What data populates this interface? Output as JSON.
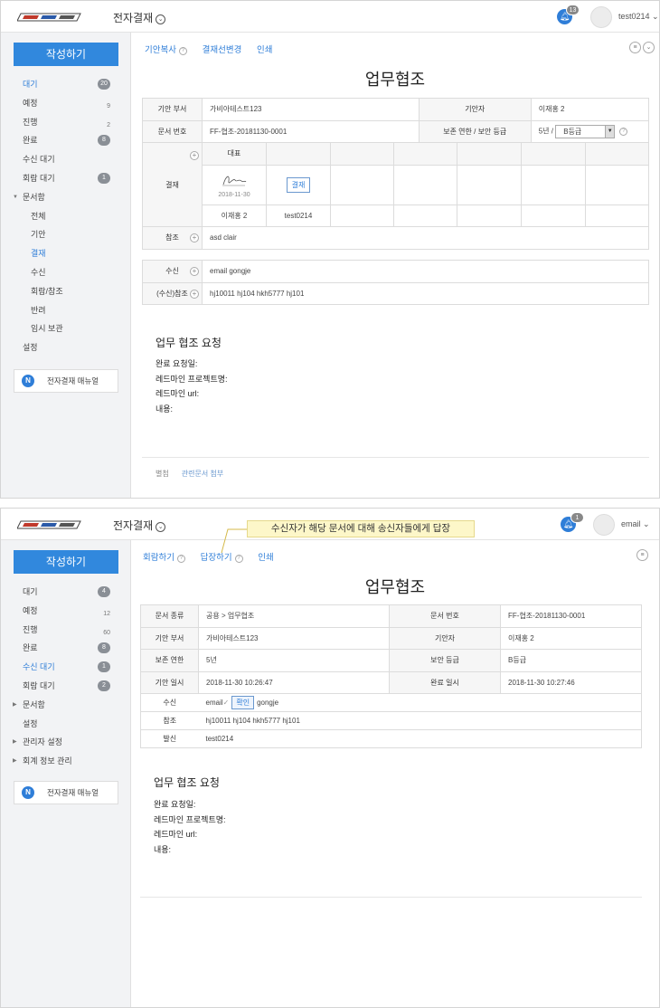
{
  "panel1": {
    "app_title": "전자결재",
    "notification_count": "13",
    "username": "test0214",
    "sidebar": {
      "write_button": "작성하기",
      "items": [
        {
          "label": "대기",
          "count": "20",
          "badge": true
        },
        {
          "label": "예정",
          "count": "9",
          "badge": false
        },
        {
          "label": "진행",
          "count": "2",
          "badge": false
        },
        {
          "label": "완료",
          "count": "8",
          "badge": true
        },
        {
          "label": "수신 대기",
          "count": "",
          "badge": false
        },
        {
          "label": "회람 대기",
          "count": "1",
          "badge": true
        },
        {
          "label": "문서함",
          "count": "",
          "badge": false
        },
        {
          "label": "전체",
          "count": "",
          "badge": false
        },
        {
          "label": "기안",
          "count": "",
          "badge": false
        },
        {
          "label": "결재",
          "count": "",
          "badge": false
        },
        {
          "label": "수신",
          "count": "",
          "badge": false
        },
        {
          "label": "회람/참조",
          "count": "",
          "badge": false
        },
        {
          "label": "반려",
          "count": "",
          "badge": false
        },
        {
          "label": "임시 보관",
          "count": "",
          "badge": false
        },
        {
          "label": "설정",
          "count": "",
          "badge": false
        }
      ],
      "manual": "전자결재 매뉴얼"
    },
    "toolbar": {
      "copy": "기안복사",
      "change_line": "결재선변경",
      "print": "인쇄"
    },
    "doc_title": "업무협조",
    "info": {
      "dept_label": "기안 부서",
      "dept_value": "가비아테스트123",
      "drafter_label": "기안자",
      "drafter_value": "이재홍 2",
      "doc_no_label": "문서 번호",
      "doc_no_value": "FF-협조-20181130-0001",
      "retention_label": "보존 연한 / 보안 등급",
      "retention_value": "5년 /",
      "security_value": "B등급"
    },
    "approval": {
      "label": "결재",
      "col_header": "대표",
      "date": "2018-11-30",
      "approver1": "이재홍 2",
      "approve_button": "결재",
      "approver2": "test0214"
    },
    "ref": {
      "label": "참조",
      "value": "asd clair"
    },
    "recipient": {
      "label": "수신",
      "value": "email gongje"
    },
    "recipient_ref": {
      "label": "(수신)참조",
      "value": "hj10011 hj104 hkh5777 hj101"
    },
    "body": {
      "title": "업무 협조 요청",
      "lines": [
        "완료 요청일:",
        "레드마인 프로젝트명:",
        "레드마인 url:",
        "내용:"
      ]
    },
    "attach": {
      "label": "별첨",
      "link": "관련문서 첨부"
    }
  },
  "panel2": {
    "app_title": "전자결재",
    "notification_count": "1",
    "username": "email",
    "callout": "수신자가 해당 문서에 대해 송신자들에게 답장",
    "sidebar": {
      "write_button": "작성하기",
      "items": [
        {
          "label": "대기",
          "count": "4",
          "badge": true
        },
        {
          "label": "예정",
          "count": "12",
          "badge": false
        },
        {
          "label": "진행",
          "count": "60",
          "badge": false
        },
        {
          "label": "완료",
          "count": "8",
          "badge": true
        },
        {
          "label": "수신 대기",
          "count": "1",
          "badge": true
        },
        {
          "label": "회람 대기",
          "count": "2",
          "badge": true
        },
        {
          "label": "문서함",
          "count": "",
          "badge": false
        },
        {
          "label": "설정",
          "count": "",
          "badge": false
        },
        {
          "label": "관리자 설정",
          "count": "",
          "badge": false
        },
        {
          "label": "회계 정보 관리",
          "count": "",
          "badge": false
        }
      ],
      "manual": "전자결재 매뉴얼"
    },
    "toolbar": {
      "circulate": "회람하기",
      "reply": "답장하기",
      "print": "인쇄"
    },
    "doc_title": "업무협조",
    "info": {
      "type_label": "문서 종류",
      "type_value": "공용 > 업무협조",
      "doc_no_label": "문서 번호",
      "doc_no_value": "FF-협조-20181130-0001",
      "dept_label": "기안 부서",
      "dept_value": "가비아테스트123",
      "drafter_label": "기안자",
      "drafter_value": "이재홍 2",
      "retention_label": "보존 연한",
      "retention_value": "5년",
      "security_label": "보안 등급",
      "security_value": "B등급",
      "draft_date_label": "기안 일시",
      "draft_date_value": "2018-11-30 10:26:47",
      "complete_date_label": "완료 일시",
      "complete_date_value": "2018-11-30 10:27:46"
    },
    "recipients": {
      "recv_label": "수신",
      "recv_value1": "email",
      "confirm_button": "확인",
      "recv_value2": "gongje",
      "ref_label": "참조",
      "ref_value": "hj10011 hj104 hkh5777 hj101",
      "sender_label": "발신",
      "sender_value": "test0214"
    },
    "body": {
      "title": "업무 협조 요청",
      "lines": [
        "완료 요청일:",
        "레드마인 프로젝트명:",
        "레드마인 url:",
        "내용:"
      ]
    }
  }
}
